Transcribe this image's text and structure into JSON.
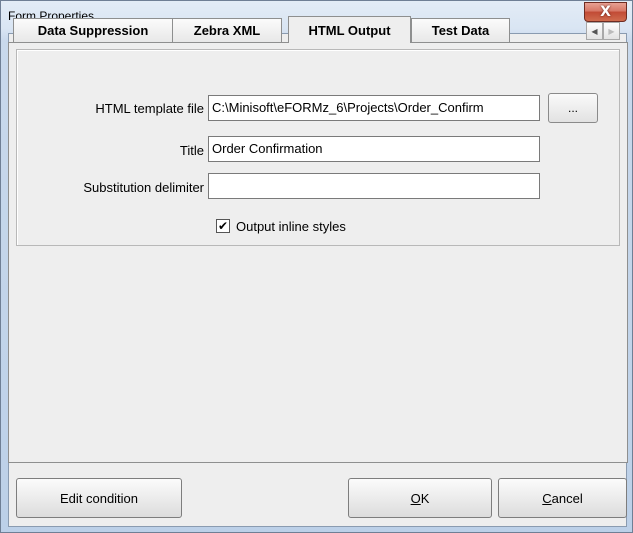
{
  "window": {
    "title": "Form Properties",
    "close_glyph": "X"
  },
  "tabs": [
    {
      "label": "Data Suppression",
      "active": false
    },
    {
      "label": "Zebra XML",
      "active": false
    },
    {
      "label": "HTML Output",
      "active": true
    },
    {
      "label": "Test Data",
      "active": false
    }
  ],
  "tab_scroll": {
    "left_glyph": "◀",
    "right_glyph": "▶"
  },
  "form": {
    "template_label": "HTML template file",
    "template_value": "C:\\Minisoft\\eFORMz_6\\Projects\\Order_Confirm",
    "browse_label": "...",
    "title_label": "Title",
    "title_value": "Order Confirmation",
    "delimiter_label": "Substitution delimiter",
    "delimiter_value": "",
    "inline_styles_label": "Output inline styles",
    "inline_styles_checked": true,
    "check_glyph": "✔"
  },
  "buttons": {
    "edit_condition": "Edit condition",
    "ok_mnemonic": "O",
    "ok_rest": "K",
    "cancel_mnemonic": "C",
    "cancel_rest": "ancel"
  }
}
